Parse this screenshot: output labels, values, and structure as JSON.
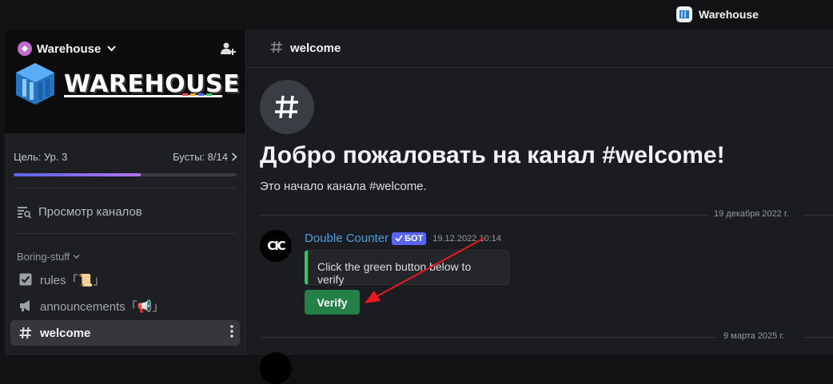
{
  "titlebar": {
    "app_title": "Warehouse"
  },
  "sidebar": {
    "server_name": "Warehouse",
    "logo_text": "WAREHOUSE",
    "boost": {
      "goal": "Цель: Ур. 3",
      "boosts": "Бусты: 8/14",
      "progress": 0.57
    },
    "browse_label": "Просмотр каналов",
    "category": "Boring-stuff",
    "channels": [
      {
        "label": "rules「📜」"
      },
      {
        "label": "announcements「📢」"
      },
      {
        "label": "welcome"
      }
    ]
  },
  "main": {
    "channel_name": "welcome",
    "welcome_title": "Добро пожаловать на канал #welcome!",
    "welcome_subtitle": "Это начало канала #welcome.",
    "date_separators": [
      "19 декабря 2022 г.",
      "9 марта 2025 г."
    ],
    "message": {
      "avatar_text": "CIC",
      "author": "Double Counter",
      "bot_badge": "БОТ",
      "timestamp": "19.12.2022 10:14",
      "embed_text": "Click the green button below to verify",
      "button_label": "Verify"
    }
  },
  "colors": {
    "accent": "#5865f2",
    "success": "#248046",
    "embed_border": "#2dc770",
    "author": "#4a9fe0",
    "annotation_arrow": "#e8191f"
  }
}
